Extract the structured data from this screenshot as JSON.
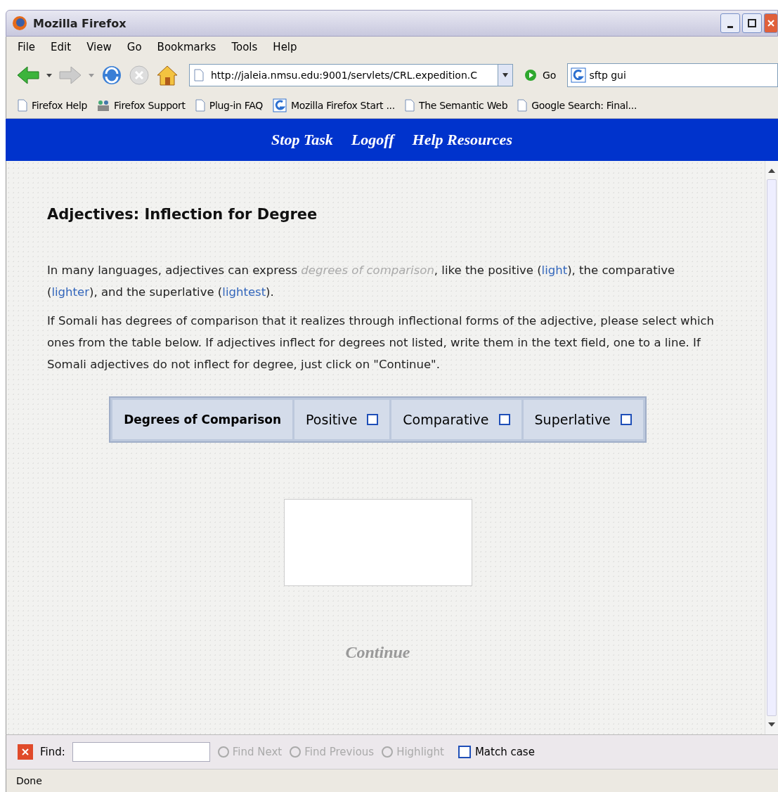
{
  "window": {
    "title": "Mozilla Firefox"
  },
  "menu": [
    "File",
    "Edit",
    "View",
    "Go",
    "Bookmarks",
    "Tools",
    "Help"
  ],
  "navigation": {
    "url": "http://jaleia.nmsu.edu:9001/servlets/CRL.expedition.C",
    "go": "Go",
    "search": "sftp gui"
  },
  "bookmarks": [
    {
      "label": "Firefox Help",
      "kind": "page"
    },
    {
      "label": "Firefox Support",
      "kind": "support"
    },
    {
      "label": "Plug-in FAQ",
      "kind": "page"
    },
    {
      "label": "Mozilla Firefox Start ...",
      "kind": "google"
    },
    {
      "label": "The Semantic Web",
      "kind": "page"
    },
    {
      "label": "Google Search: Final...",
      "kind": "page"
    }
  ],
  "site_nav": [
    "Stop Task",
    "Logoff",
    "Help Resources"
  ],
  "heading": "Adjectives: Inflection for Degree",
  "intro": [
    {
      "kind": "text",
      "text": "In many languages, adjectives can express "
    },
    {
      "kind": "term",
      "text": "degrees of comparison"
    },
    {
      "kind": "text",
      "text": ", like the positive ("
    },
    {
      "kind": "link",
      "text": "light"
    },
    {
      "kind": "text",
      "text": "), the comparative ("
    },
    {
      "kind": "link",
      "text": "lighter"
    },
    {
      "kind": "text",
      "text": "), and the superlative ("
    },
    {
      "kind": "link",
      "text": "lightest"
    },
    {
      "kind": "text",
      "text": ")."
    }
  ],
  "instructions": "If Somali has degrees of comparison that it realizes through inflectional forms of the adjective, please select which ones from the table below. If adjectives inflect for degrees not listed, write them in the text field, one to a line. If Somali adjectives do not inflect for degree, just click on \"Continue\".",
  "table": {
    "header": "Degrees of Comparison",
    "options": [
      {
        "label": "Positive",
        "checked": false
      },
      {
        "label": "Comparative",
        "checked": false
      },
      {
        "label": "Superlative",
        "checked": false
      }
    ]
  },
  "continue": {
    "label": "Continue",
    "disabled": true
  },
  "find_bar": {
    "label": "Find:",
    "buttons": [
      {
        "label": "Find Next",
        "disabled": true
      },
      {
        "label": "Find Previous",
        "disabled": true
      },
      {
        "label": "Highlight",
        "disabled": true
      }
    ],
    "match_case": {
      "label": "Match case",
      "checked": false
    }
  },
  "status_bar": "Done"
}
